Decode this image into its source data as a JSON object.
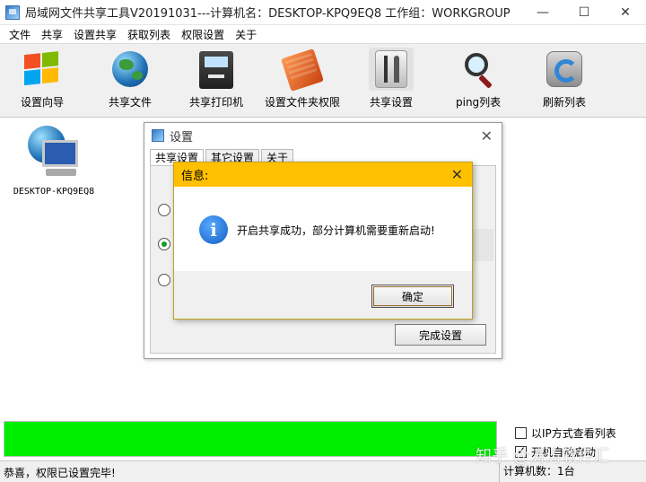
{
  "window": {
    "title": "局域网文件共享工具V20191031---计算机名：DESKTOP-KPQ9EQ8 工作组：WORKGROUP",
    "controls": {
      "minimize": "—",
      "maximize": "☐",
      "close": "✕"
    }
  },
  "menu": [
    "文件",
    "共享",
    "设置共享",
    "获取列表",
    "权限设置",
    "关于"
  ],
  "toolbar": [
    {
      "label": "设置向导",
      "icon": "windows-logo-icon"
    },
    {
      "label": "共享文件",
      "icon": "globe-icon"
    },
    {
      "label": "共享打印机",
      "icon": "printer-icon"
    },
    {
      "label": "设置文件夹权限",
      "icon": "folder-permission-icon"
    },
    {
      "label": "共享设置",
      "icon": "tools-icon"
    },
    {
      "label": "ping列表",
      "icon": "magnifier-icon"
    },
    {
      "label": "刷新列表",
      "icon": "refresh-icon"
    }
  ],
  "computers": [
    {
      "name": "DESKTOP-KPQ9EQ8",
      "icon": "network-computer-icon"
    }
  ],
  "settings_dialog": {
    "title": "设置",
    "close": "✕",
    "tabs": [
      "共享设置",
      "其它设置",
      "关于"
    ],
    "active_tab": 0,
    "finish_button": "完成设置",
    "radios": [
      {
        "checked": false
      },
      {
        "checked": true
      },
      {
        "checked": false
      }
    ]
  },
  "message_box": {
    "title": "信息:",
    "close": "✕",
    "icon": "info-icon",
    "icon_glyph": "i",
    "text": "开启共享成功，部分计算机需要重新启动!",
    "ok_button": "确定"
  },
  "progress": {
    "value": 1.0,
    "color": "#00ee00"
  },
  "options": [
    {
      "label": "以IP方式查看列表",
      "checked": false
    },
    {
      "label": "开机自动启动",
      "checked": true
    }
  ],
  "status": {
    "message": "恭喜，权限已设置完毕!",
    "count": "计算机数：1台"
  },
  "watermark": "知乎 @涛涛软件汇"
}
